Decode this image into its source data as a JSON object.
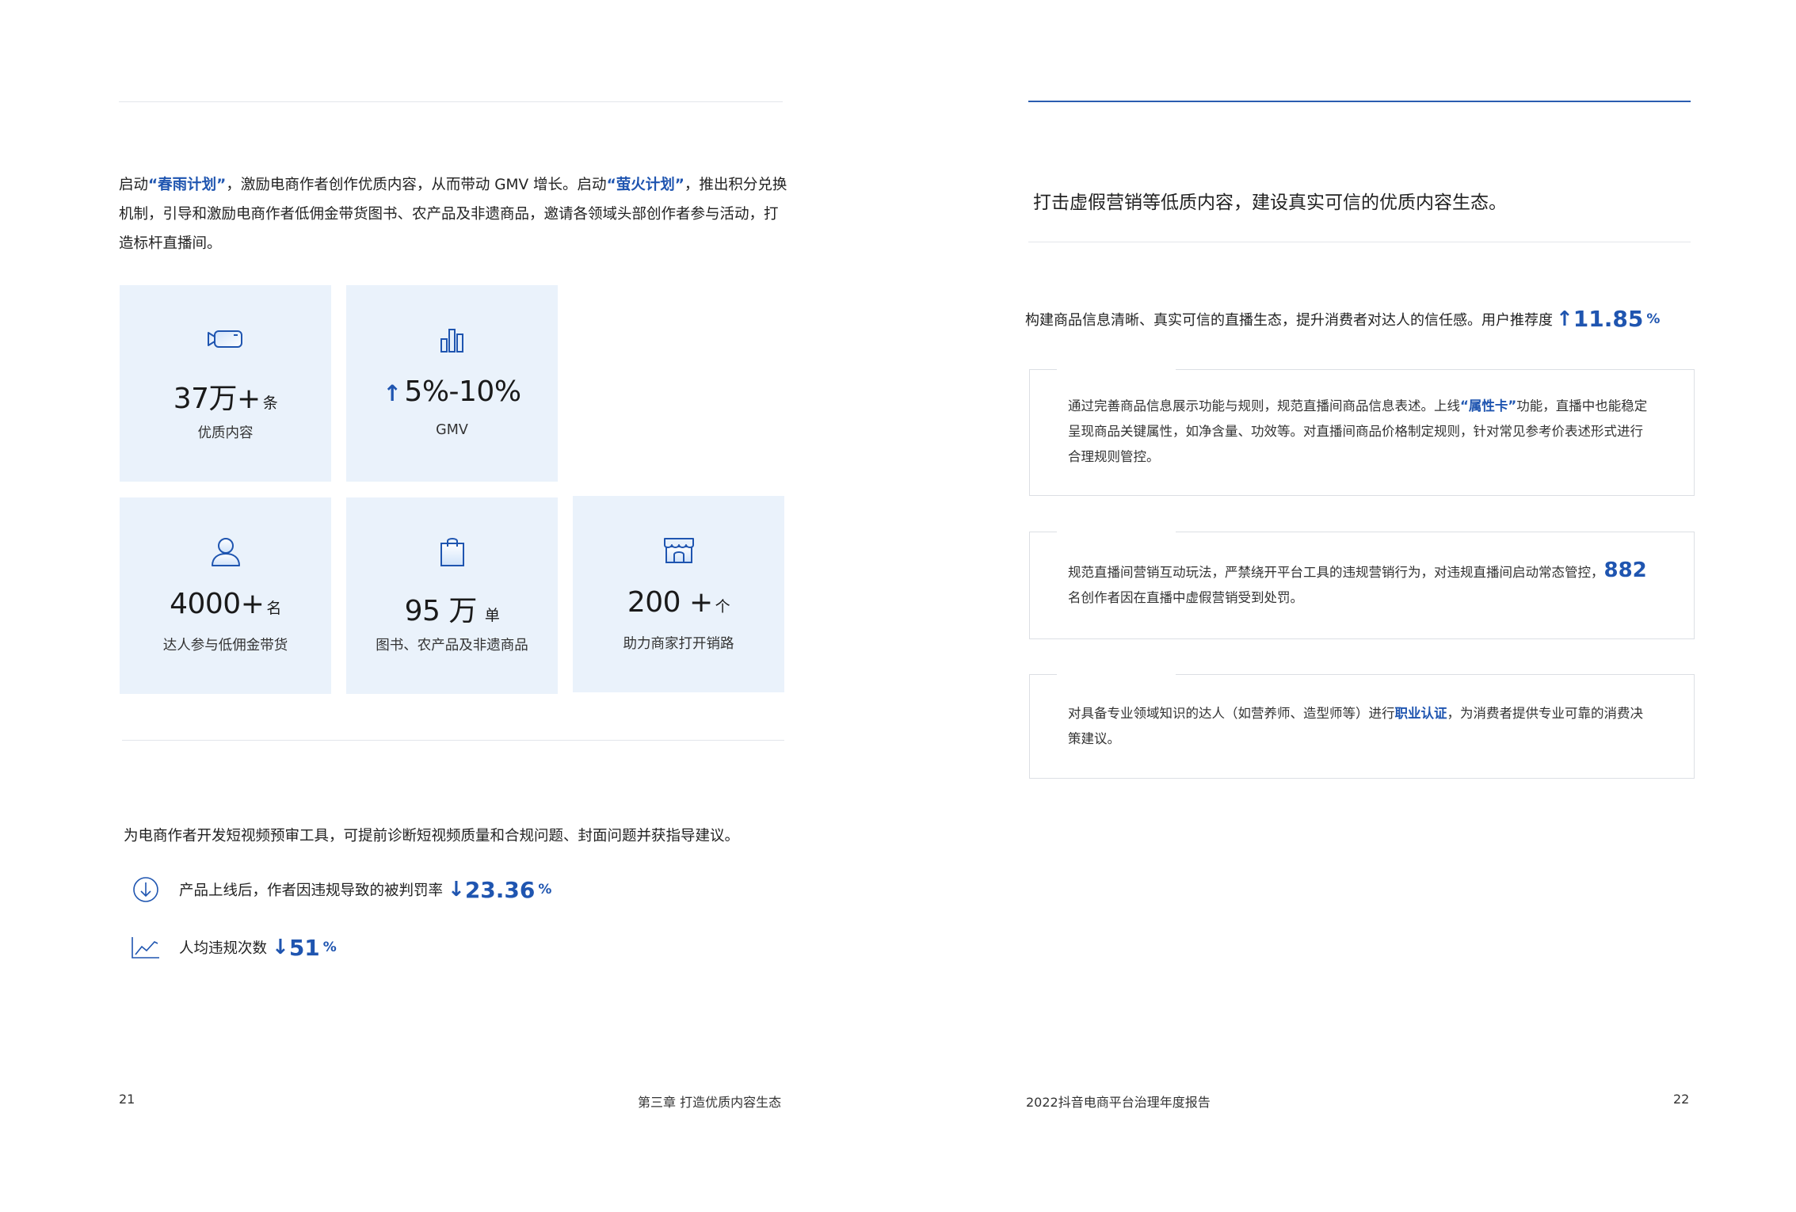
{
  "left": {
    "intro": {
      "p1": "启动",
      "h1": "“春雨计划”",
      "p2": "，激励电商作者创作优质内容，从而带动 GMV 增长。启动",
      "h2": "“萤火计划”",
      "p3": "，推出积分兑换机制，引导和激励电商作者低佣金带货图书、农产品及非遗商品，邀请各领域头部创作者参与活动，打造标杆直播间。"
    },
    "cards": [
      {
        "icon": "video-camera-icon",
        "value": "37万+",
        "unit": "条",
        "label": "优质内容"
      },
      {
        "icon": "bar-chart-icon",
        "value": "5%-10%",
        "unit": "",
        "label": "GMV"
      },
      {
        "icon": "person-icon",
        "value": "4000+",
        "unit": "名",
        "label": "达人参与低佣金带货"
      },
      {
        "icon": "shopping-bag-icon",
        "value": "95 万",
        "unit": "单",
        "label": "图书、农产品及非遗商品"
      },
      {
        "icon": "storefront-icon",
        "value": "200 +",
        "unit": "个",
        "label": "助力商家打开销路"
      }
    ],
    "review_tool": "为电商作者开发短视频预审工具，可提前诊断短视频质量和合规问题、封面问题并获指导建议。",
    "metrics": [
      {
        "icon": "down-circle-icon",
        "label": "产品上线后，作者因违规导致的被判罚率",
        "value": "23.36",
        "unit": "%"
      },
      {
        "icon": "line-trend-icon",
        "label": "人均违规次数",
        "value": "51",
        "unit": "%"
      }
    ],
    "page_number": "21",
    "chapter": "第三章 打造优质内容生态"
  },
  "right": {
    "headline": "打击虚假营销等低质内容，建设真实可信的优质内容生态。",
    "sub": {
      "text": "构建商品信息清晰、真实可信的直播生态，提升消费者对达人的信任感。用户推荐度",
      "value": "11.85",
      "unit": "%"
    },
    "box1": {
      "p1": "通过完善商品信息展示功能与规则，规范直播间商品信息表述。上线",
      "h1": "“属性卡”",
      "p2": "功能，直播中也能稳定呈现商品关键属性，如净含量、功效等。对直播间商品价格制定规则，针对常见参考价表述形式进行合理规则管控。"
    },
    "box2": {
      "p1": "规范直播间营销互动玩法，严禁绕开平台工具的违规营销行为，对违规直播间启动常态管控，",
      "num": "882",
      "p2": " 名创作者因在直播中虚假营销受到处罚。"
    },
    "box3": {
      "p1": "对具备专业领域知识的达人（如营养师、造型师等）进行",
      "h1": "职业认证",
      "p2": "，为消费者提供专业可靠的消费决策建议。"
    },
    "report_title": "2022抖音电商平台治理年度报告",
    "page_number": "22"
  },
  "colors": {
    "accent": "#1f55b0",
    "card_bg": "#eaf2fb",
    "rule_blue": "#2a5db0"
  }
}
